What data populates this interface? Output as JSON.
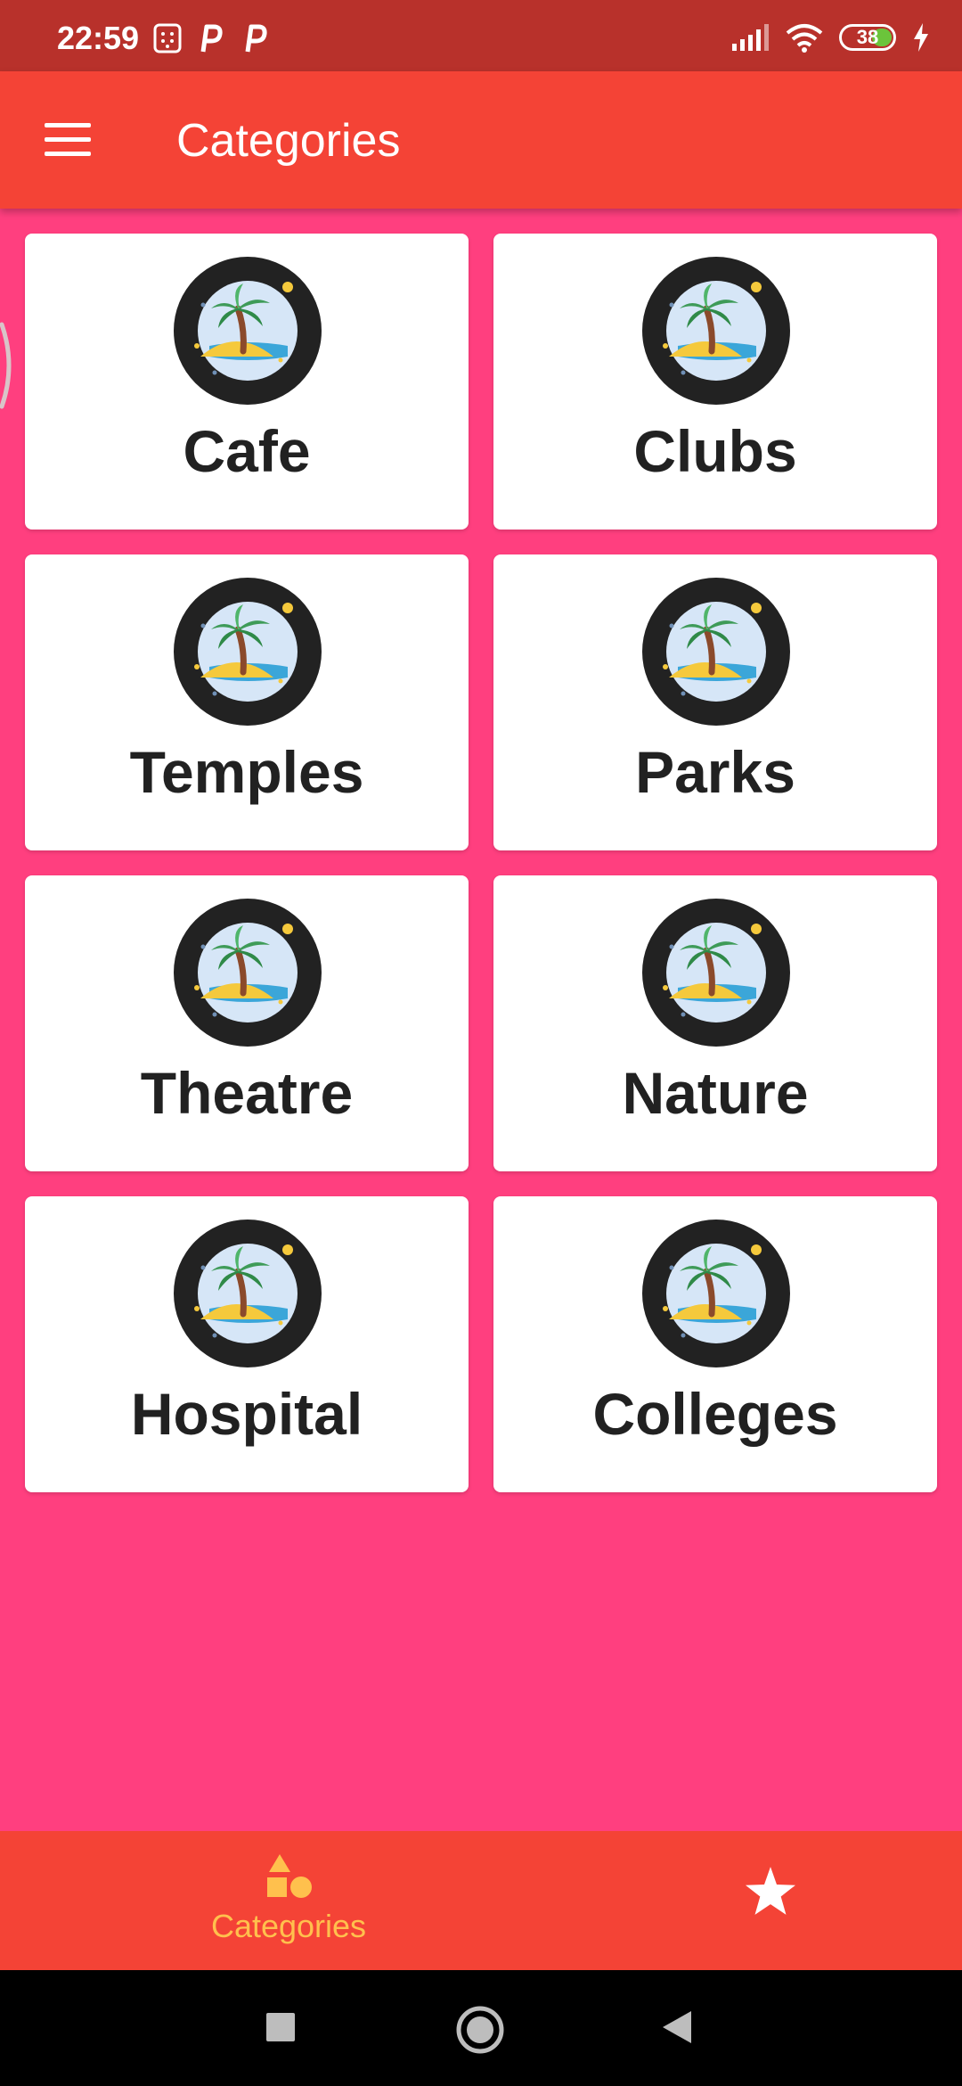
{
  "status_bar": {
    "time": "22:59",
    "notification_icons": [
      "sim-card-icon",
      "parking-p-icon",
      "parking-p-icon"
    ],
    "signal_icon": "signal-icon",
    "wifi_icon": "wifi-icon",
    "battery_level": "38",
    "charging_icon": "bolt-icon"
  },
  "app_bar": {
    "menu_icon": "menu-icon",
    "title": "Categories"
  },
  "categories": [
    {
      "label": "Cafe",
      "icon": "palm-island-icon"
    },
    {
      "label": "Clubs",
      "icon": "palm-island-icon"
    },
    {
      "label": "Temples",
      "icon": "palm-island-icon"
    },
    {
      "label": "Parks",
      "icon": "palm-island-icon"
    },
    {
      "label": "Theatre",
      "icon": "palm-island-icon"
    },
    {
      "label": "Nature",
      "icon": "palm-island-icon"
    },
    {
      "label": "Hospital",
      "icon": "palm-island-icon"
    },
    {
      "label": "Colleges",
      "icon": "palm-island-icon"
    }
  ],
  "bottom_nav": {
    "items": [
      {
        "label": "Categories",
        "icon": "shapes-icon",
        "active": true
      },
      {
        "label": "",
        "icon": "star-icon",
        "active": false
      }
    ]
  },
  "system_nav": {
    "buttons": [
      "recents-square-icon",
      "home-circle-icon",
      "back-triangle-icon"
    ]
  },
  "colors": {
    "status_bar": "#B8312B",
    "app_bar": "#F44336",
    "background": "#FF3F7F",
    "card": "#FFFFFF",
    "active_nav": "#FFC04D"
  }
}
